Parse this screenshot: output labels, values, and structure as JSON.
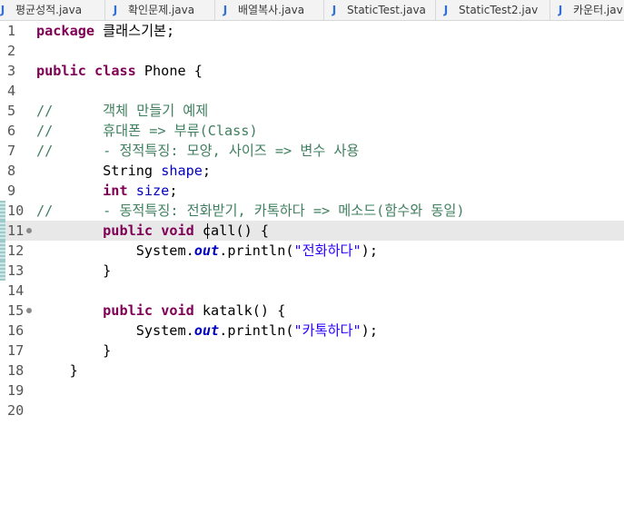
{
  "tabs": [
    {
      "label": "평균성적.java"
    },
    {
      "label": "확인문제.java"
    },
    {
      "label": "배열복사.java"
    },
    {
      "label": "StaticTest.java"
    },
    {
      "label": "StaticTest2.jav"
    },
    {
      "label": "카운터.jav"
    }
  ],
  "tab_icon_glyph": "J",
  "editor": {
    "line_numbers": [
      "1",
      "2",
      "3",
      "4",
      "5",
      "6",
      "7",
      "8",
      "9",
      "10",
      "11",
      "12",
      "13",
      "14",
      "15",
      "16",
      "17",
      "18",
      "19",
      "20"
    ],
    "line1": {
      "kw": "package",
      "rest": " 클래스기본;"
    },
    "line3": {
      "kw1": "public",
      "sp1": " ",
      "kw2": "class",
      "rest": " Phone {"
    },
    "line5": {
      "comment": "//\t\t객체 만들기 예제"
    },
    "line6": {
      "comment": "//\t\t휴대폰 => 부류(Class)"
    },
    "line7": {
      "comment": "//\t\t- 정적특징: 모양, 사이즈 => 변수 사용"
    },
    "line8": {
      "indent": "\t\t",
      "type": "String",
      "sp": " ",
      "field": "shape",
      "end": ";"
    },
    "line9": {
      "indent": "\t\t",
      "kw": "int",
      "sp": " ",
      "field": "size",
      "end": ";"
    },
    "line10": {
      "comment": "//\t\t- 동적특징: 전화받기, 카톡하다 => 메소드(함수와 동일)"
    },
    "line11": {
      "indent": "\t\t",
      "kw1": "public",
      "sp": " ",
      "kw2": "void",
      "rest": " call() {"
    },
    "line12": {
      "indent": "\t\t\t",
      "pre": "System.",
      "sf": "out",
      "mid": ".println(",
      "str": "\"전화하다\"",
      "end": ");"
    },
    "line13": {
      "text": "\t\t}"
    },
    "line15": {
      "indent": "\t\t",
      "kw1": "public",
      "sp": " ",
      "kw2": "void",
      "rest": " katalk() {"
    },
    "line16": {
      "indent": "\t\t\t",
      "pre": "System.",
      "sf": "out",
      "mid": ".println(",
      "str": "\"카톡하다\"",
      "end": ");"
    },
    "line17": {
      "text": "\t\t}"
    },
    "line18": {
      "text": "\t}"
    }
  },
  "colors": {
    "keyword": "#7f0055",
    "comment": "#3f7f5f",
    "field": "#0000c0",
    "string": "#2a00ff",
    "current_line": "#e8e8e8"
  }
}
